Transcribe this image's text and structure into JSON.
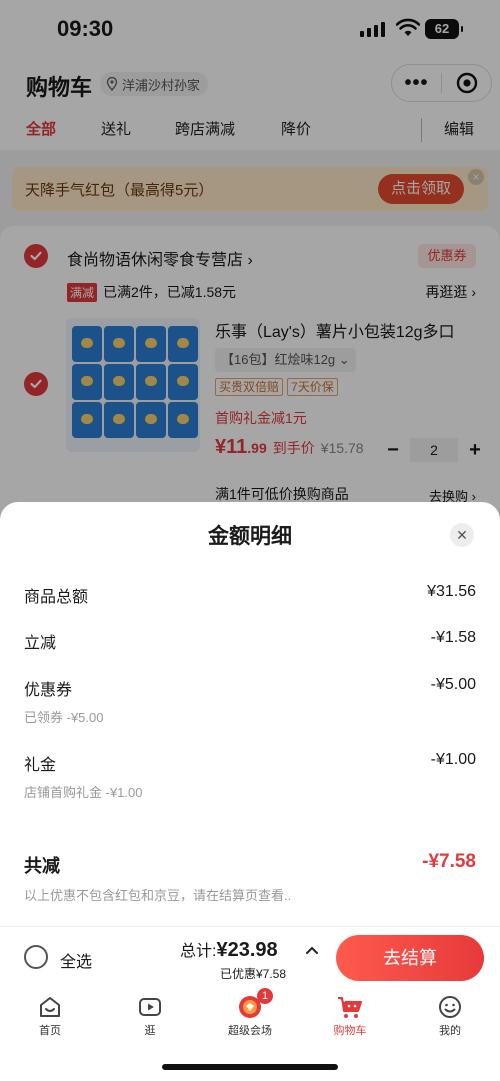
{
  "status": {
    "time": "09:30",
    "battery": "62"
  },
  "header": {
    "title": "购物车",
    "location": "洋浦沙村孙家"
  },
  "tabs": [
    "全部",
    "送礼",
    "跨店满减",
    "降价"
  ],
  "edit_label": "编辑",
  "banner": {
    "text": "天降手气红包（最高得5元）",
    "button": "点击领取"
  },
  "shop": {
    "name": "食尚物语休闲零食专营店",
    "coupon_tag": "优惠券",
    "manjian_tag": "满减",
    "manjian_text": "已满2件，已减1.58元",
    "more": "再逛逛"
  },
  "product": {
    "name": "乐事（Lay's）薯片小包装12g多口",
    "spec": "【16包】红烩味12g",
    "badges": [
      "买贵双倍赔",
      "7天价保"
    ],
    "gift": "首购礼金减1元",
    "price_main": "¥11",
    "price_decimal": ".99",
    "price_label": "到手价",
    "original_price": "¥15.78",
    "quantity": "2",
    "swap_text": "满1件可低价换购商品",
    "swap_link": "去换购"
  },
  "sheet": {
    "title": "金额明细",
    "rows": [
      {
        "label": "商品总额",
        "value": "¥31.56"
      },
      {
        "label": "立减",
        "value": "-¥1.58"
      },
      {
        "label": "优惠券",
        "value": "-¥5.00",
        "sub": "已领券 -¥5.00"
      },
      {
        "label": "礼金",
        "value": "-¥1.00",
        "sub": "店铺首购礼金 -¥1.00"
      }
    ],
    "total_label": "共减",
    "total_value": "-¥7.58",
    "note": "以上优惠不包含红包和京豆，请在结算页查看.."
  },
  "checkout": {
    "select_all": "全选",
    "sum_label": "总计:",
    "sum_value": "¥23.98",
    "saved": "已优惠¥7.58",
    "button": "去结算"
  },
  "tabbar": {
    "items": [
      "首页",
      "逛",
      "超级会场",
      "购物车",
      "我的"
    ],
    "badge": "1"
  },
  "colors": {
    "accent": "#e4393c",
    "banner_bg": "#fde8c8"
  }
}
